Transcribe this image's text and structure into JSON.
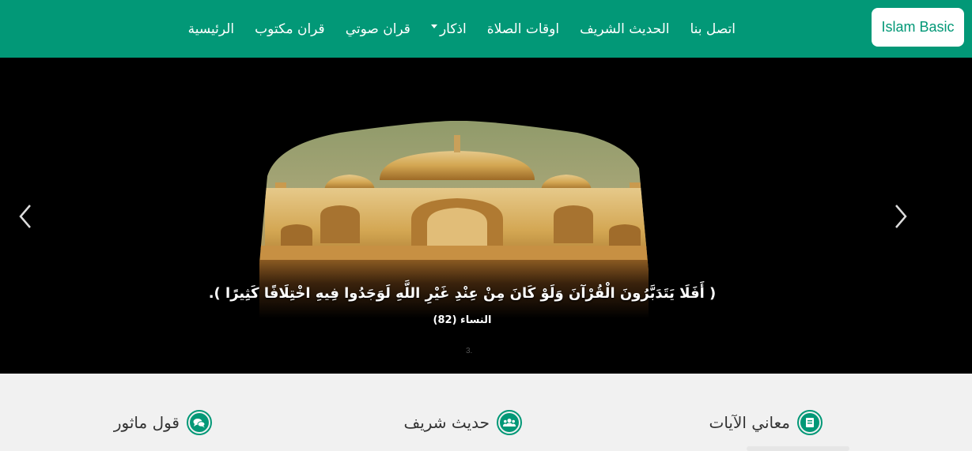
{
  "navbar": {
    "brand": "Islam Basic",
    "items": [
      {
        "label": "الرئيسية",
        "dropdown": false
      },
      {
        "label": "قران مكتوب",
        "dropdown": false
      },
      {
        "label": "قران صوتي",
        "dropdown": false
      },
      {
        "label": "اذكار",
        "dropdown": true
      },
      {
        "label": "اوقات الصلاة",
        "dropdown": false
      },
      {
        "label": "الحديث الشريف",
        "dropdown": false
      },
      {
        "label": "اتصل بنا",
        "dropdown": false
      }
    ]
  },
  "carousel": {
    "verse": "( أَفَلَا يَتَدَبَّرُونَ الْقُرْآنَ وَلَوْ كَانَ مِنْ عِنْدِ غَيْرِ اللَّهِ لَوَجَدُوا فِيهِ اخْتِلَافًا كَثِيرًا ).",
    "reference": "النساء (82)",
    "indicator": "3.",
    "prev_icon": "chevron-left-icon",
    "next_icon": "chevron-right-icon"
  },
  "cards": [
    {
      "title": "معاني الآيات",
      "icon": "book-icon"
    },
    {
      "title": "حديث شريف",
      "icon": "users-icon"
    },
    {
      "title": "قول ماثور",
      "icon": "comments-icon"
    }
  ],
  "colors": {
    "primary": "#029877",
    "dark_bg": "#000000",
    "light_bg": "#f1f1f1"
  }
}
